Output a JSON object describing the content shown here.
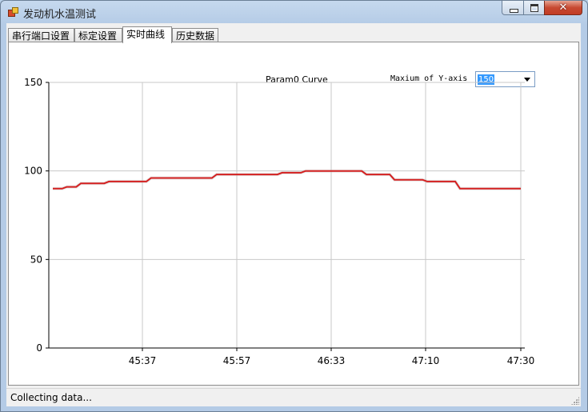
{
  "window": {
    "title": "发动机水温测试",
    "controls": {
      "close_label": "✕"
    }
  },
  "tabs": [
    {
      "label": "串行端口设置",
      "active": false
    },
    {
      "label": "标定设置",
      "active": false
    },
    {
      "label": "实时曲线",
      "active": true
    },
    {
      "label": "历史数据",
      "active": false
    }
  ],
  "curve_panel": {
    "curve_title": "Param0 Curve",
    "ymax_label": "Maxium of Y-axis",
    "ymax_value": "150"
  },
  "status": {
    "text": "Collecting data..."
  },
  "chart_data": {
    "type": "line",
    "title": "Param0 Curve",
    "xlabel": "",
    "ylabel": "",
    "ylim": [
      0,
      150
    ],
    "yticks": [
      0,
      50,
      100,
      150
    ],
    "xticks": [
      "45:37",
      "45:57",
      "46:33",
      "47:10",
      "47:30"
    ],
    "x_range_note": "xticks evenly spaced; data spans slightly before 45:37 to 47:30",
    "grid": true,
    "legend": "none",
    "series": [
      {
        "color": "#d42020",
        "points": [
          [
            0.0,
            90
          ],
          [
            0.02,
            90
          ],
          [
            0.03,
            91
          ],
          [
            0.05,
            91
          ],
          [
            0.06,
            93
          ],
          [
            0.11,
            93
          ],
          [
            0.12,
            94
          ],
          [
            0.2,
            94
          ],
          [
            0.21,
            96
          ],
          [
            0.34,
            96
          ],
          [
            0.35,
            98
          ],
          [
            0.48,
            98
          ],
          [
            0.49,
            99
          ],
          [
            0.53,
            99
          ],
          [
            0.54,
            100
          ],
          [
            0.66,
            100
          ],
          [
            0.67,
            98
          ],
          [
            0.72,
            98
          ],
          [
            0.73,
            95
          ],
          [
            0.79,
            95
          ],
          [
            0.8,
            94
          ],
          [
            0.86,
            94
          ],
          [
            0.87,
            90
          ],
          [
            1.0,
            90
          ]
        ]
      }
    ]
  }
}
